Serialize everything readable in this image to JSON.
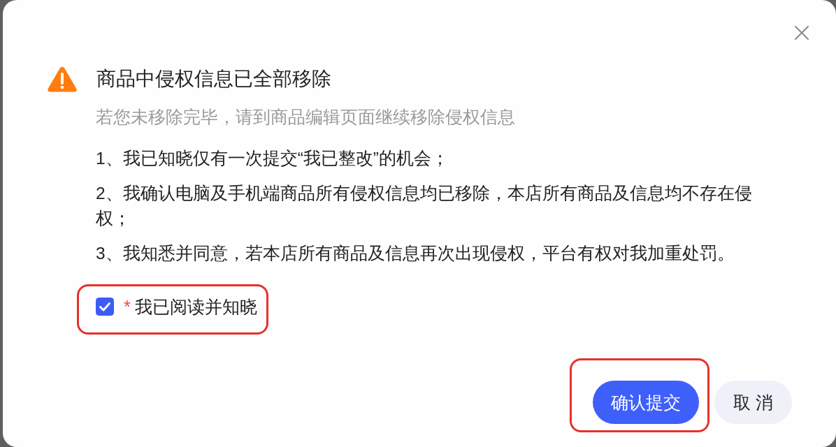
{
  "dialog": {
    "title": "商品中侵权信息已全部移除",
    "subtitle": "若您未移除完毕，请到商品编辑页面继续移除侵权信息",
    "statements": [
      "1、我已知晓仅有一次提交“我已整改”的机会；",
      "2、我确认电脑及手机端商品所有侵权信息均已移除，本店所有商品及信息均不存在侵权；",
      "3、我知悉并同意，若本店所有商品及信息再次出现侵权，平台有权对我加重处罚。"
    ],
    "consent": {
      "required_mark": "*",
      "label": "我已阅读并知晓",
      "checked": true,
      "highlighted": true
    },
    "buttons": [
      {
        "label": "确认提交",
        "kind": "primary",
        "highlighted": true
      },
      {
        "label": "取 消",
        "kind": "secondary",
        "highlighted": false
      }
    ]
  }
}
